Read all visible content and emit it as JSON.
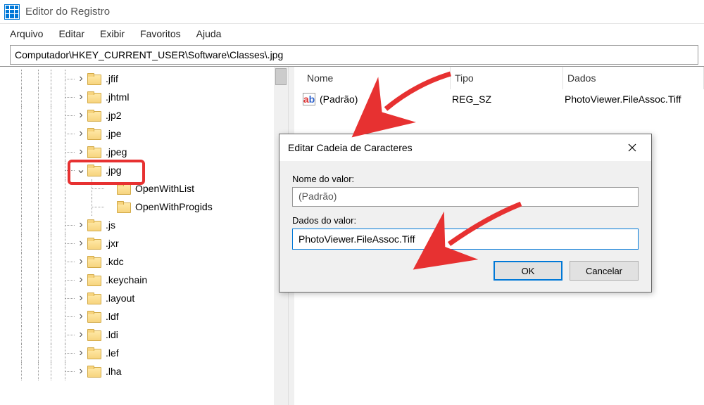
{
  "window": {
    "title": "Editor do Registro"
  },
  "menu": {
    "file": "Arquivo",
    "edit": "Editar",
    "view": "Exibir",
    "favorites": "Favoritos",
    "help": "Ajuda"
  },
  "address": {
    "path": "Computador\\HKEY_CURRENT_USER\\Software\\Classes\\.jpg"
  },
  "tree": {
    "items": [
      {
        "label": ".jfif",
        "expandable": true
      },
      {
        "label": ".jhtml",
        "expandable": true
      },
      {
        "label": ".jp2",
        "expandable": true
      },
      {
        "label": ".jpe",
        "expandable": true
      },
      {
        "label": ".jpeg",
        "expandable": true
      },
      {
        "label": ".jpg",
        "expandable": true,
        "expanded": true,
        "highlighted": true,
        "children": [
          {
            "label": "OpenWithList"
          },
          {
            "label": "OpenWithProgids"
          }
        ]
      },
      {
        "label": ".js",
        "expandable": true
      },
      {
        "label": ".jxr",
        "expandable": true
      },
      {
        "label": ".kdc",
        "expandable": true
      },
      {
        "label": ".keychain",
        "expandable": true
      },
      {
        "label": ".layout",
        "expandable": true
      },
      {
        "label": ".ldf",
        "expandable": true
      },
      {
        "label": ".ldi",
        "expandable": true
      },
      {
        "label": ".lef",
        "expandable": true
      },
      {
        "label": ".lha",
        "expandable": true
      }
    ]
  },
  "list": {
    "headers": {
      "name": "Nome",
      "type": "Tipo",
      "data": "Dados"
    },
    "row": {
      "name": "(Padrão)",
      "type": "REG_SZ",
      "data": "PhotoViewer.FileAssoc.Tiff"
    }
  },
  "dialog": {
    "title": "Editar Cadeia de Caracteres",
    "name_label": "Nome do valor:",
    "name_value": "(Padrão)",
    "data_label": "Dados do valor:",
    "data_value": "PhotoViewer.FileAssoc.Tiff",
    "ok": "OK",
    "cancel": "Cancelar"
  }
}
